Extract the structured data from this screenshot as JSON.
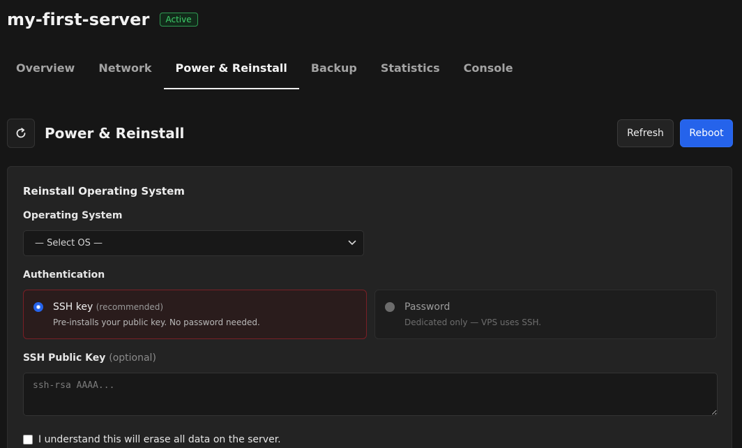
{
  "header": {
    "server_name": "my-first-server",
    "status": "Active",
    "status_color": "#3ecf6a"
  },
  "tabs": [
    {
      "label": "Overview",
      "active": false
    },
    {
      "label": "Network",
      "active": false
    },
    {
      "label": "Power & Reinstall",
      "active": true
    },
    {
      "label": "Backup",
      "active": false
    },
    {
      "label": "Statistics",
      "active": false
    },
    {
      "label": "Console",
      "active": false
    }
  ],
  "section": {
    "icon": "refresh-icon",
    "title": "Power & Reinstall",
    "refresh_label": "Refresh",
    "reboot_label": "Reboot",
    "accent_color": "#2563eb"
  },
  "reinstall": {
    "title": "Reinstall Operating System",
    "os_label": "Operating System",
    "os_selected": "— Select OS —",
    "auth_label": "Authentication",
    "ssh_option": {
      "title": "SSH key",
      "hint": "(recommended)",
      "description": "Pre-installs your public key. No password needed.",
      "selected": true
    },
    "password_option": {
      "title": "Password",
      "description": "Dedicated only — VPS uses SSH.",
      "selected": false
    },
    "ssh_key_label": "SSH Public Key",
    "ssh_key_hint": "(optional)",
    "ssh_key_placeholder": "ssh-rsa AAAA...",
    "ssh_key_value": "",
    "confirm_label": "I understand this will erase all data on the server.",
    "confirm_checked": false
  }
}
